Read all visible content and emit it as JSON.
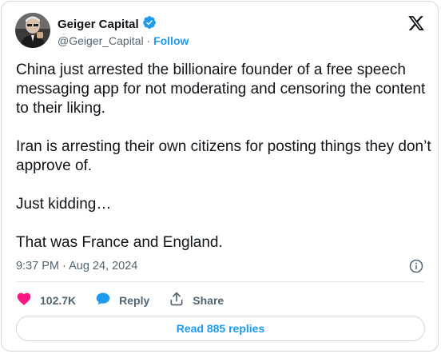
{
  "author": {
    "name": "Geiger Capital",
    "handle": "@Geiger_Capital",
    "separator": "·",
    "follow_label": "Follow"
  },
  "tweet": {
    "paragraphs": [
      "China just arrested the billionaire founder of a free speech messaging app for not moderating and censoring the content to their liking.",
      "Iran is arresting their own citizens for posting things they don’t approve of.",
      "Just kidding…",
      "That was France and England."
    ],
    "timestamp": "9:37 PM · Aug 24, 2024"
  },
  "actions": {
    "like_count": "102.7K",
    "reply_label": "Reply",
    "share_label": "Share"
  },
  "read_replies_label": "Read 885 replies",
  "colors": {
    "accent": "#1d9bf0",
    "like": "#f91880",
    "text": "#0f1419",
    "muted": "#536471",
    "border": "#cfd9de"
  },
  "icons": [
    "verified-badge-icon",
    "x-logo-icon",
    "info-icon",
    "heart-icon",
    "reply-bubble-icon",
    "share-icon"
  ]
}
